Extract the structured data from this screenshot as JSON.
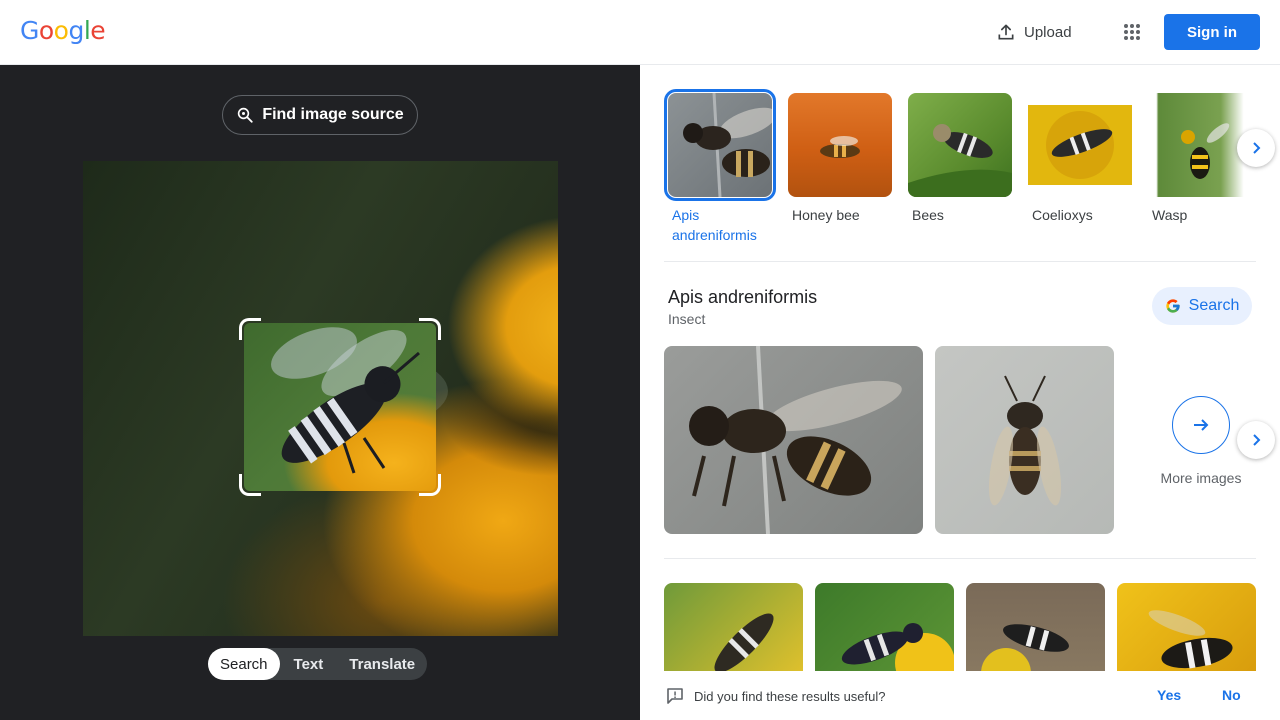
{
  "header": {
    "logo": "Google",
    "upload_label": "Upload",
    "apps_icon": "apps-grid-icon",
    "signin_label": "Sign in"
  },
  "lens": {
    "find_source_label": "Find image source",
    "modes": [
      "Search",
      "Text",
      "Translate"
    ],
    "active_mode": "Search"
  },
  "results": {
    "related": [
      {
        "label": "Apis andreniformis",
        "selected": true
      },
      {
        "label": "Honey bee",
        "selected": false
      },
      {
        "label": "Bees",
        "selected": false
      },
      {
        "label": "Coelioxys",
        "selected": false
      },
      {
        "label": "Wasp",
        "selected": false
      }
    ],
    "entity": {
      "title": "Apis andreniformis",
      "subtitle": "Insect",
      "search_label": "Search",
      "more_images_label": "More images"
    }
  },
  "feedback": {
    "question": "Did you find these results useful?",
    "yes": "Yes",
    "no": "No"
  },
  "colors": {
    "accent": "#1a73e8",
    "dark_pane": "#202124"
  }
}
